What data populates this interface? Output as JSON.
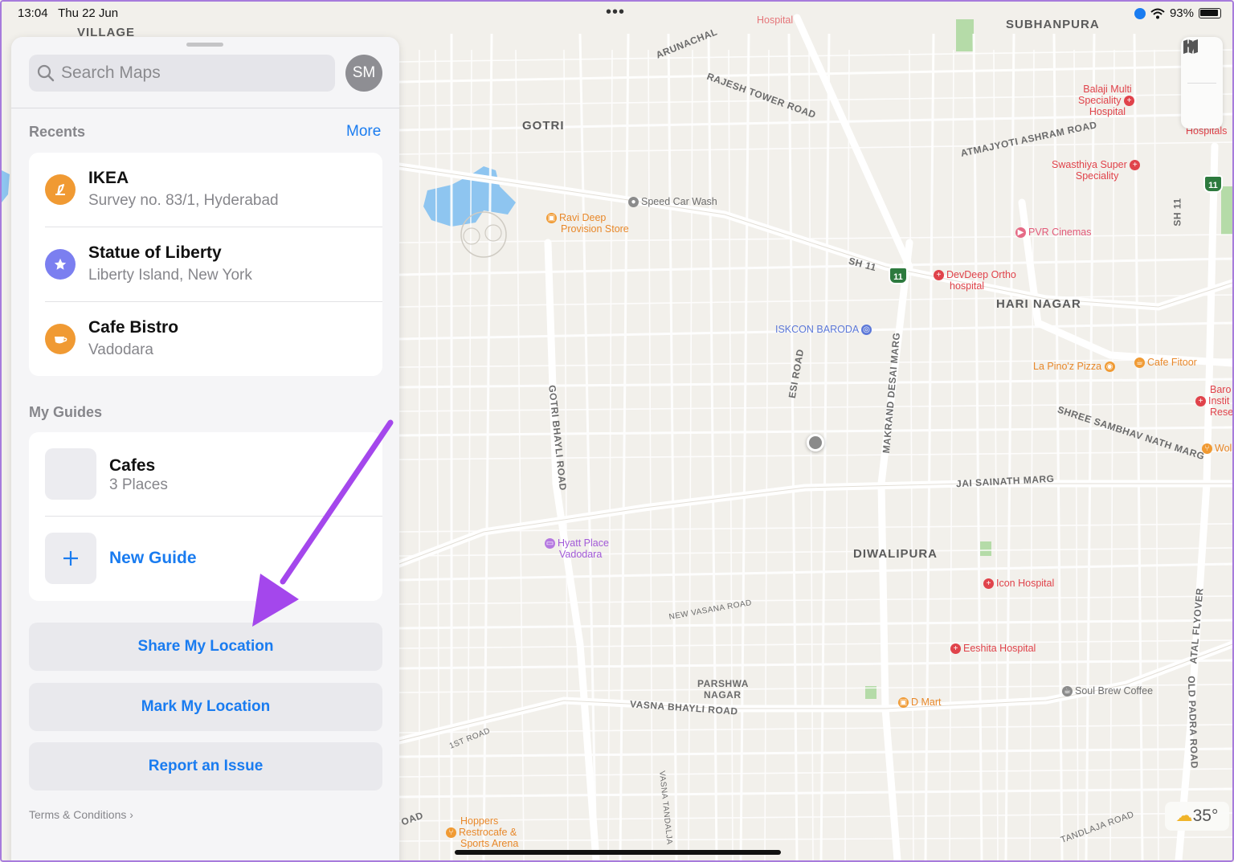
{
  "status_bar": {
    "time": "13:04",
    "date": "Thu 22 Jun",
    "more_dots": "•••",
    "battery_percent": "93%"
  },
  "sidebar": {
    "search_placeholder": "Search Maps",
    "avatar_initials": "SM",
    "recents_title": "Recents",
    "more_label": "More",
    "recents": [
      {
        "name": "IKEA",
        "address": "Survey no. 83/1, Hyderabad",
        "icon": "shopping-icon",
        "color": "#f09a33"
      },
      {
        "name": "Statue of Liberty",
        "address": "Liberty Island, New York",
        "icon": "star-icon",
        "color": "#7b7ff0"
      },
      {
        "name": "Cafe Bistro",
        "address": "Vadodara",
        "icon": "cafe-icon",
        "color": "#f09a33"
      }
    ],
    "guides_title": "My Guides",
    "guides": [
      {
        "name": "Cafes",
        "count": "3 Places"
      }
    ],
    "new_guide_label": "New Guide",
    "actions": {
      "share": "Share My Location",
      "mark": "Mark My Location",
      "report": "Report an Issue"
    },
    "terms_label": "Terms & Conditions"
  },
  "map": {
    "areas": {
      "village": "VILLAGE",
      "subhanpura": "SUBHANPURA",
      "gotri": "GOTRI",
      "hari_nagar": "HARI NAGAR",
      "diwalipura": "DIWALIPURA",
      "parshwa_nagar_1": "PARSHWA",
      "parshwa_nagar_2": "NAGAR"
    },
    "roads": {
      "arunachal": "ARUNACHAL",
      "rajesh_tower": "RAJESH TOWER ROAD",
      "atmajyoti": "ATMAJYOTI ASHRAM ROAD",
      "sh11": "SH 11",
      "sh11_right": "SH 11",
      "esi": "ESI ROAD",
      "makrand": "MAKRAND DESAI MARG",
      "gotri_bhayli": "GOTRI BHAYLI ROAD",
      "shree_sambhav": "SHREE SAMBHAV NATH MARG",
      "jai_sainath": "JAI SAINATH MARG",
      "new_vasana": "NEW VASANA ROAD",
      "vasna_bhayli": "VASNA BHAYLI ROAD",
      "first_road": "1ST ROAD",
      "vasna_tandalja": "VASNA TANDALJA",
      "tandlaja": "TANDLAJA ROAD",
      "atal_flyover": "ATAL FLYOVER",
      "old_padra": "OLD PADRA ROAD",
      "oad": "OAD"
    },
    "highway_number": "11",
    "pois": {
      "balaji_1": "Balaji Multi",
      "balaji_2": "Speciality",
      "balaji_3": "Hospital",
      "hospitals": "Hospitals",
      "swasthiya_1": "Swasthiya Super",
      "swasthiya_2": "Speciality",
      "speed_car_wash": "Speed Car Wash",
      "ravi_1": "Ravi Deep",
      "ravi_2": "Provision Store",
      "pvr": "PVR Cinemas",
      "devdeep_1": "DevDeep Ortho",
      "devdeep_2": "hospital",
      "iskcon": "ISKCON BARODA",
      "la_pinoz": "La Pino'z Pizza",
      "cafe_fitoor": "Cafe Fitoor",
      "baro_1": "Baro",
      "baro_2": "Instit",
      "baro_3": "Rese",
      "wol": "Wol",
      "hyatt_1": "Hyatt Place",
      "hyatt_2": "Vadodara",
      "icon_hospital": "Icon Hospital",
      "eeshita": "Eeshita Hospital",
      "dmart": "D Mart",
      "soul_brew": "Soul Brew Coffee",
      "hoppers_1": "Hoppers",
      "hoppers_2": "Restrocafe &",
      "hoppers_3": "Sports Arena",
      "hospital_top": "Hospital"
    },
    "temperature": "35°"
  }
}
